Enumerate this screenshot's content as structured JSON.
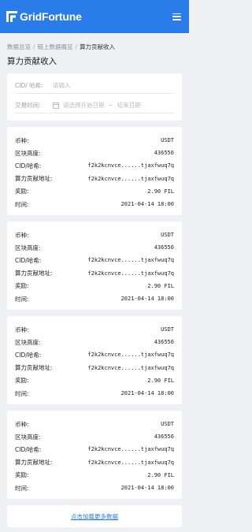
{
  "header": {
    "brand": "GridFortune"
  },
  "breadcrumb": {
    "items": [
      "数据总览",
      "链上数据概览"
    ],
    "current": "算力贡献收入"
  },
  "page_title": "算力贡献收入",
  "filters": {
    "cid_label": "CID/ 哈希:",
    "cid_placeholder": "请输入",
    "time_label": "交易时间:",
    "start_placeholder": "请选择开始日期",
    "range_sep": "~",
    "end_placeholder": "结束日期"
  },
  "labels": {
    "currency": "币种:",
    "height": "区块高度:",
    "cid": "CID/哈希:",
    "address": "算力贡献地址:",
    "reward": "奖励:",
    "time": "时间:"
  },
  "records": [
    {
      "currency": "USDT",
      "height": "436556",
      "cid": "f2k2kcnvce......tjaxfwuq7q",
      "address": "f2k2kcnvce......tjaxfwuq7q",
      "reward": "2.90 FIL",
      "time": "2021-04-14 18:00"
    },
    {
      "currency": "USDT",
      "height": "436556",
      "cid": "f2k2kcnvce......tjaxfwuq7q",
      "address": "f2k2kcnvce......tjaxfwuq7q",
      "reward": "2.90 FIL",
      "time": "2021-04-14 18:00"
    },
    {
      "currency": "USDT",
      "height": "436556",
      "cid": "f2k2kcnvce......tjaxfwuq7q",
      "address": "f2k2kcnvce......tjaxfwuq7q",
      "reward": "2.90 FIL",
      "time": "2021-04-14 18:00"
    },
    {
      "currency": "USDT",
      "height": "436556",
      "cid": "f2k2kcnvce......tjaxfwuq7q",
      "address": "f2k2kcnvce......tjaxfwuq7q",
      "reward": "2.90 FIL",
      "time": "2021-04-14 18:00"
    }
  ],
  "load_more": "点击加载更多数据",
  "icons": {
    "logo": "gridfortune-logo-icon",
    "menu": "hamburger-menu-icon",
    "calendar": "calendar-icon"
  },
  "colors": {
    "brand": "#2a7ce8",
    "background": "#eef0f4"
  }
}
